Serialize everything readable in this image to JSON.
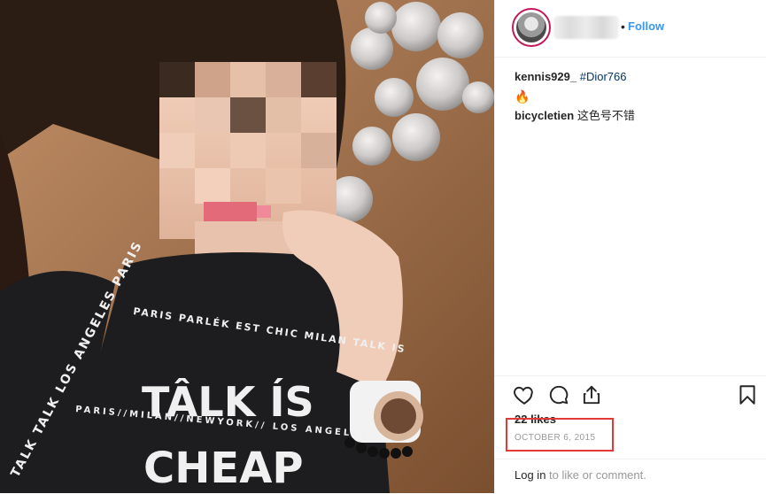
{
  "post": {
    "author": {
      "follow_label": "Follow",
      "separator": "•"
    },
    "comments": [
      {
        "user": "kennis929_",
        "text": "#Dior766"
      },
      {
        "emoji": "🔥"
      },
      {
        "user": "bicycletien",
        "text": "这色号不错"
      }
    ],
    "likes": "22 likes",
    "date": "OCTOBER 6, 2015",
    "footer": {
      "login": "Log in",
      "rest": " to like or comment."
    },
    "shirt_text": {
      "line1": "TÂLK ÍS",
      "line2": "CHEAP",
      "arc_text": "PARIS PARLÉK EST CHIC MILAN TALK IS",
      "band_text": "PARIS//MILAN//NEWYORK// LOS ANGELES",
      "side_text": "TALK TALK LOS ANGELES PARIS"
    },
    "icons": [
      "heart-icon",
      "comment-icon",
      "share-icon",
      "bookmark-icon"
    ],
    "colors": {
      "accent": "#3897f0",
      "highlight": "#e53935"
    }
  }
}
